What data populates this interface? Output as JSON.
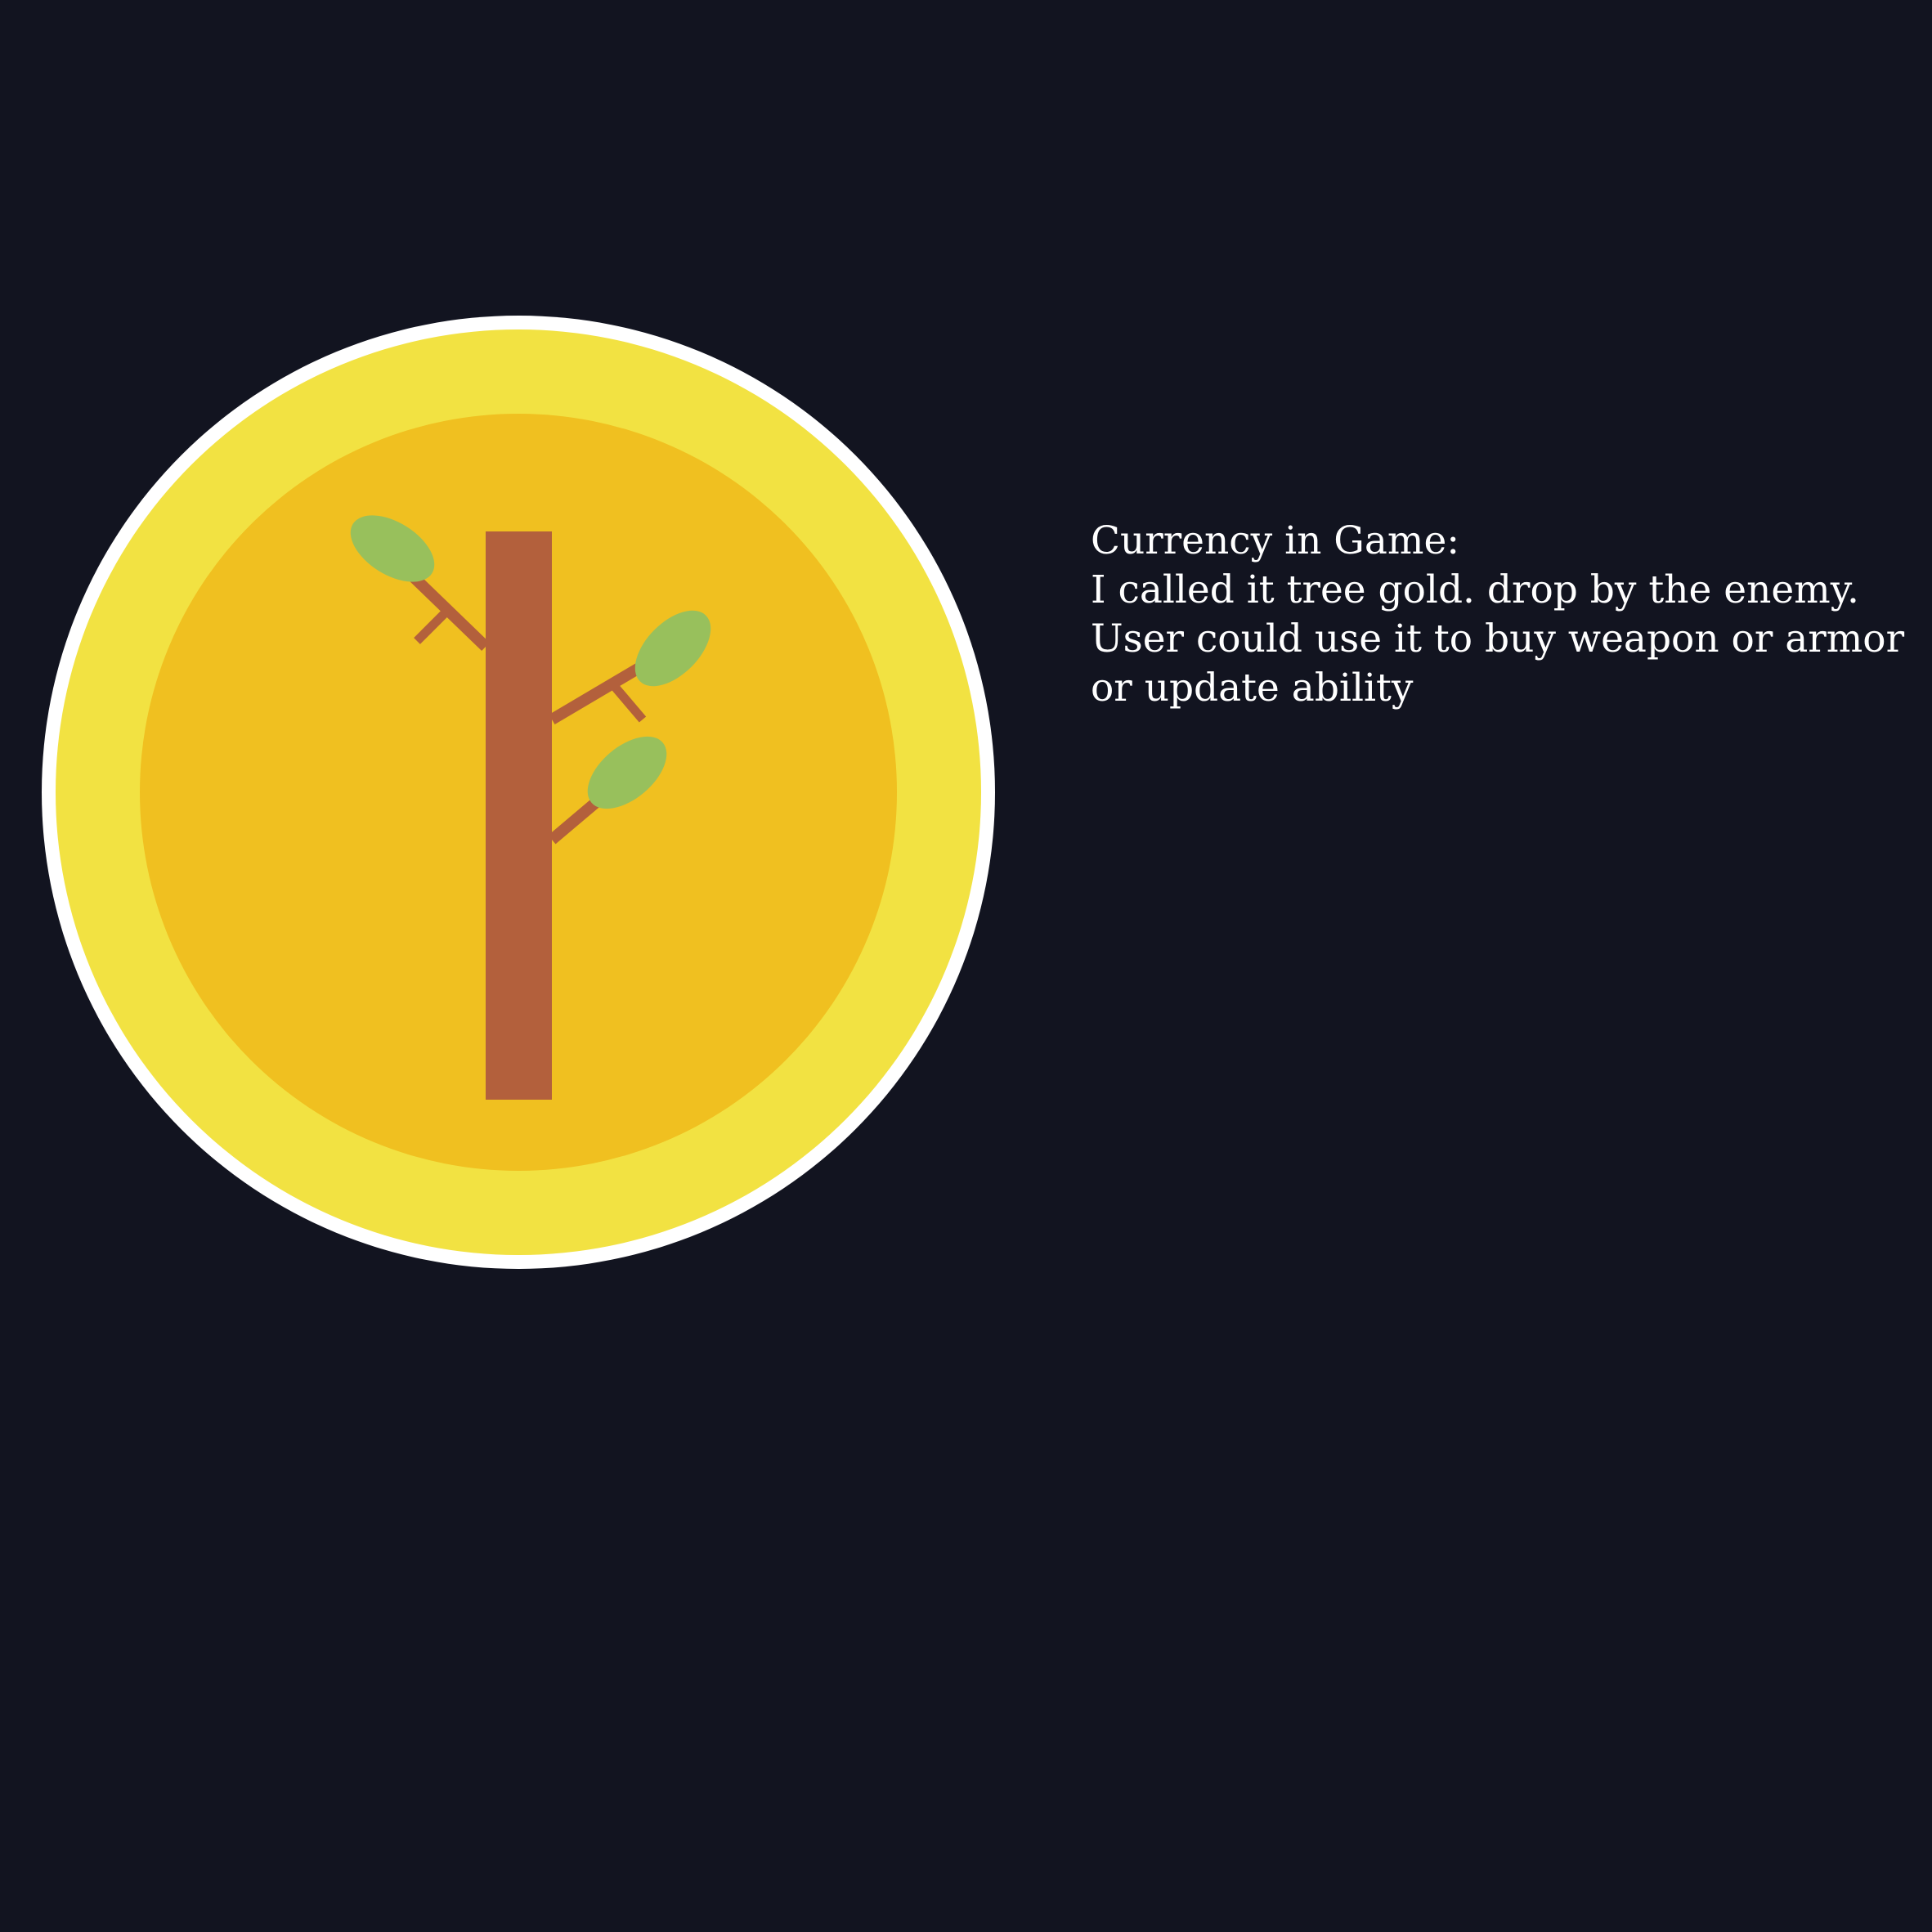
{
  "caption": {
    "lines": [
      "Currency in Game:",
      "I called it tree gold. drop by the enemy.",
      "User could use it to buy weapon or armor",
      "or update ability"
    ]
  },
  "coin": {
    "icon": "tree-gold-coin-icon",
    "colors": {
      "background": "#121420",
      "rim": "#ffffff",
      "outer_gold": "#f2e242",
      "inner_gold": "#f0c020",
      "trunk": "#b3603c",
      "leaf": "#98c05c"
    }
  }
}
